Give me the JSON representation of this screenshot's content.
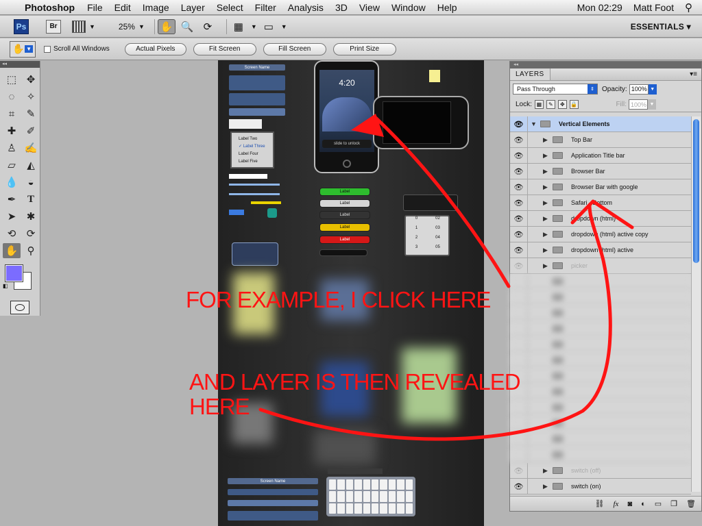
{
  "menubar": {
    "app": "Photoshop",
    "items": [
      "File",
      "Edit",
      "Image",
      "Layer",
      "Select",
      "Filter",
      "Analysis",
      "3D",
      "View",
      "Window",
      "Help"
    ],
    "clock": "Mon 02:29",
    "user": "Matt Foot"
  },
  "appbar": {
    "ps_badge": "Ps",
    "br_badge": "Br",
    "zoom": "25%",
    "workspace": "ESSENTIALS ▾"
  },
  "options": {
    "scroll_all_windows": "Scroll All Windows",
    "buttons": [
      "Actual Pixels",
      "Fit Screen",
      "Fill Screen",
      "Print Size"
    ]
  },
  "canvas": {
    "screen_name_top": "Screen Name",
    "screen_name_bottom": "Screen Name",
    "phone_time": "4:20",
    "slide_label": "slide to unlock",
    "label_buttons": [
      "Label",
      "Label",
      "Label",
      "Label",
      "Label"
    ],
    "list_labels": [
      "Label Two",
      "✓ Label Three",
      "Label Four",
      "Label Five"
    ],
    "picker_values": [
      "0",
      "02",
      "1",
      "03",
      "2",
      "04",
      "3",
      "05"
    ]
  },
  "layers_panel": {
    "title": "LAYERS",
    "blend_mode": "Pass Through",
    "opacity_label": "Opacity:",
    "opacity_value": "100%",
    "lock_label": "Lock:",
    "fill_label": "Fill:",
    "fill_value": "100%",
    "group_name": "Vertical Elements",
    "layers": [
      "Top Bar",
      "Application Title bar",
      "Browser Bar",
      "Browser Bar with google",
      "Safari - Bottom",
      "dropdown (html)",
      "dropdown (html) active copy",
      "dropdown (html) active",
      "picker"
    ],
    "bottom_layers": [
      "switch (off)",
      "switch (on)"
    ]
  },
  "annotations": {
    "click_here": "FOR EXAMPLE, I CLICK HERE",
    "revealed_line1": "AND LAYER IS THEN REVEALED",
    "revealed_line2": "HERE"
  },
  "colors": {
    "annotation": "#ff1414",
    "foreground_swatch": "#7b6cff",
    "selection": "#bdd2f2"
  }
}
